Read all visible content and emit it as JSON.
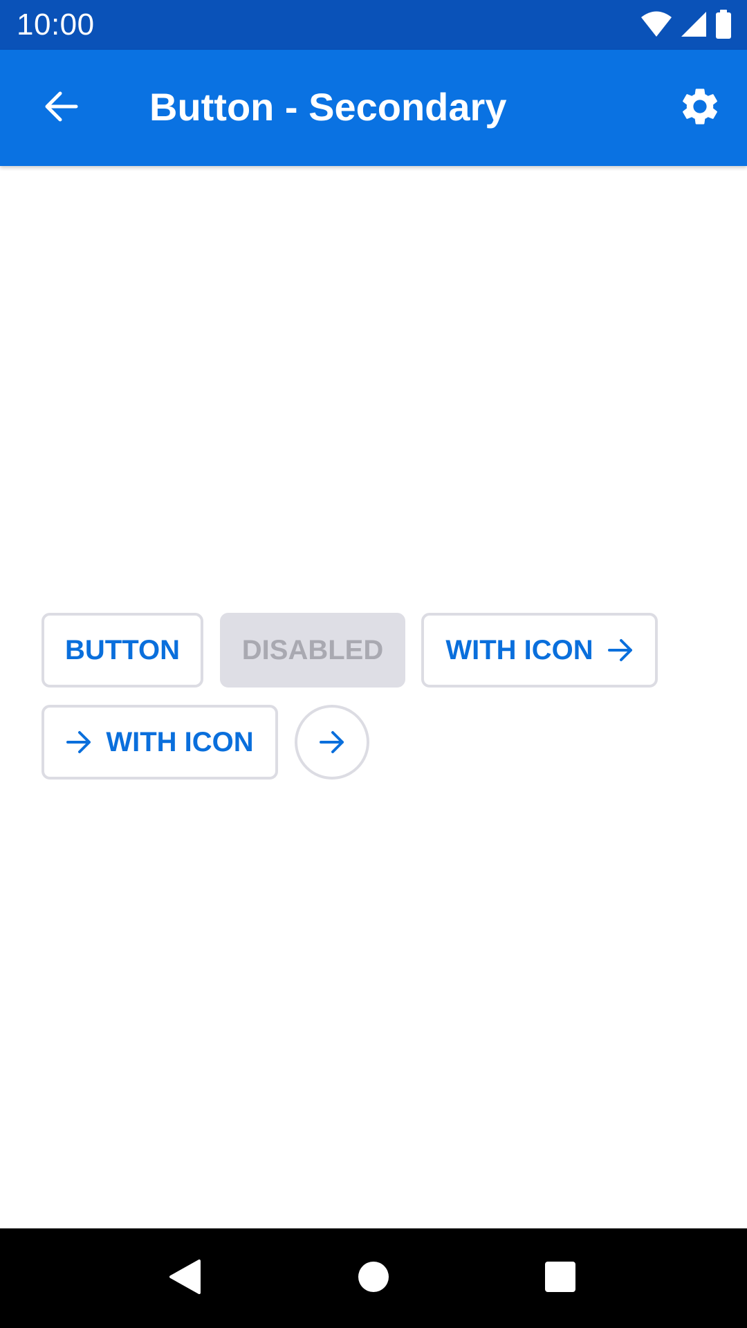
{
  "status_bar": {
    "time": "10:00",
    "icons": [
      "wifi-icon",
      "cellular-signal-icon",
      "battery-icon"
    ]
  },
  "app_bar": {
    "title": "Button - Secondary",
    "back_icon": "arrow-left-icon",
    "settings_icon": "gear-icon"
  },
  "buttons": {
    "button_label": "BUTTON",
    "disabled_label": "DISABLED",
    "with_icon_trailing_label": "WITH ICON",
    "with_icon_leading_label": "WITH ICON",
    "icon": "arrow-right-icon"
  },
  "nav_bar": {
    "icons": [
      "back-triangle-icon",
      "home-circle-icon",
      "recents-square-icon"
    ]
  },
  "colors": {
    "status_bar": "#0a52b8",
    "app_bar": "#0a72e2",
    "accent": "#0a6fdc",
    "border": "#dcdce3",
    "disabled_bg": "#dedee5",
    "disabled_text": "#a9a9b1"
  }
}
